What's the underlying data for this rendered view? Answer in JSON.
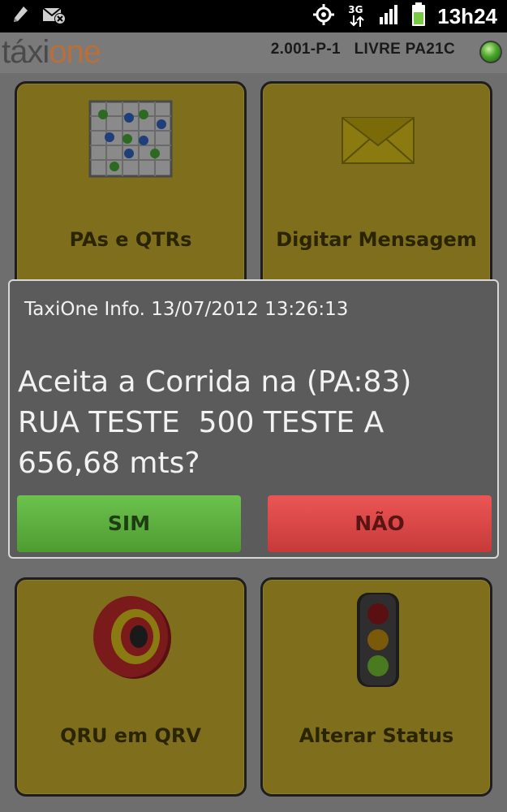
{
  "status_bar": {
    "time": "13h24",
    "network_label": "3G",
    "icons": [
      "pencil-icon",
      "mail-cancel-icon",
      "gps-icon",
      "data-3g-icon",
      "signal-icon",
      "battery-icon"
    ]
  },
  "header": {
    "logo_prefix": "táxi",
    "logo_suffix": "one",
    "status_text": "2.001-P-1   LIVRE PA21C",
    "status_color": "#4aa52a"
  },
  "tiles": [
    {
      "label": "PAs e QTRs",
      "icon": "grid-map-icon"
    },
    {
      "label": "Digitar Mensagem",
      "icon": "envelope-icon"
    },
    {
      "label": "QRU em QRV",
      "icon": "target-icon"
    },
    {
      "label": "Alterar Status",
      "icon": "traffic-light-icon"
    }
  ],
  "dialog": {
    "title": "TaxiOne Info. 13/07/2012 13:26:13",
    "message": "Aceita a Corrida na (PA:83)\nRUA TESTE  500 TESTE A\n656,68 mts?",
    "yes_label": "SIM",
    "no_label": "NÃO",
    "yes_color": "#5cb53e",
    "no_color": "#e04848"
  },
  "colors": {
    "tile_bg": "#7f6f1d",
    "logo_accent": "#b86f3a"
  }
}
